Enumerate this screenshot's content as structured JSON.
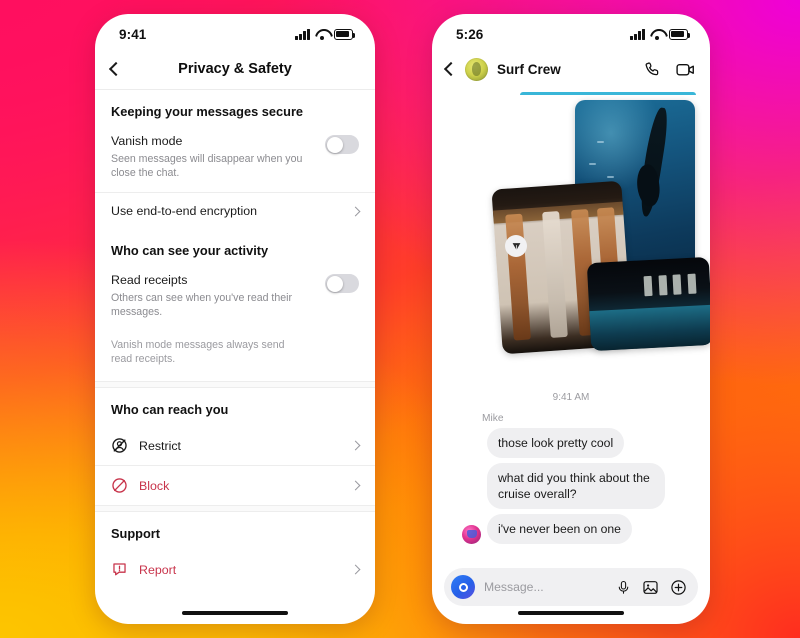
{
  "theme": {
    "accent_danger": "#c8344b",
    "bg_gradient_colors": [
      "#ef00d8",
      "#ff0f5f",
      "#ff2d1f",
      "#ff9a00",
      "#fdc500"
    ],
    "bubble_bg": "#efeff1",
    "camera_button": "#2660e8",
    "teal_edge": "#39b6d8"
  },
  "left_phone": {
    "status": {
      "time": "9:41",
      "signal": "signal-bars",
      "wifi": "wifi",
      "battery": "battery-full"
    },
    "nav": {
      "back": "back-chevron",
      "title": "Privacy & Safety"
    },
    "sections": [
      {
        "heading": "Keeping your messages secure",
        "toggle_rows": [
          {
            "title": "Vanish mode",
            "subtitle": "Seen messages will disappear when you close the chat.",
            "state": "off"
          }
        ],
        "link_rows": [
          {
            "label": "Use end-to-end encryption",
            "icon": "",
            "danger": false
          }
        ]
      },
      {
        "heading": "Who can see your activity",
        "toggle_rows": [
          {
            "title": "Read receipts",
            "subtitle": "Others can see when you've read their messages.",
            "state": "off"
          }
        ],
        "note": "Vanish mode messages always send read receipts."
      },
      {
        "heading": "Who can reach you",
        "link_rows": [
          {
            "label": "Restrict",
            "icon": "restrict-icon",
            "danger": false
          },
          {
            "label": "Block",
            "icon": "block-icon",
            "danger": true
          }
        ]
      },
      {
        "heading": "Support",
        "link_rows": [
          {
            "label": "Report",
            "icon": "report-icon",
            "danger": true
          }
        ]
      }
    ]
  },
  "right_phone": {
    "status": {
      "time": "5:26",
      "signal": "signal-bars",
      "wifi": "wifi",
      "battery": "battery-full"
    },
    "nav": {
      "back": "back-chevron",
      "title": "Surf Crew",
      "avatar": "group-avatar",
      "call_icon": "phone-icon",
      "video_icon": "video-camera-icon"
    },
    "thread": {
      "photos": [
        {
          "name": "ocean-diving-photo",
          "alt": "Underwater diver in blue ocean"
        },
        {
          "name": "interior-curtains-photo",
          "alt": "Room interior with curtains"
        },
        {
          "name": "night-pool-photo",
          "alt": "Swimming pool at night"
        }
      ],
      "share_icon": "share-icon",
      "timestamp": "9:41 AM",
      "sender": "Mike",
      "messages": [
        {
          "text": "those look pretty cool",
          "avatar": false
        },
        {
          "text": "what did you think about the cruise overall?",
          "avatar": false
        },
        {
          "text": "i've never been on one",
          "avatar": true
        }
      ]
    },
    "composer": {
      "camera_icon": "camera-icon",
      "placeholder": "Message...",
      "mic_icon": "microphone-icon",
      "gallery_icon": "image-icon",
      "add_icon": "plus-circle-icon"
    }
  }
}
